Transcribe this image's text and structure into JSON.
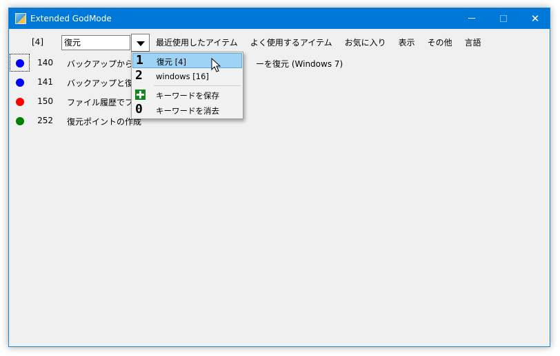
{
  "window": {
    "title": "Extended GodMode",
    "close_glyph": "✕"
  },
  "toolbar": {
    "count": "[4]",
    "search_value": "復元"
  },
  "menubar": {
    "items": [
      "最近使用したアイテム",
      "よく使用するアイテム",
      "お気に入り",
      "表示",
      "その他",
      "言語"
    ]
  },
  "rows": [
    {
      "color": "#0000ff",
      "number": "140",
      "label_left": "バックアップからデー",
      "label_right": "ーを復元 (Windows 7)"
    },
    {
      "color": "#0000ff",
      "number": "141",
      "label": "バックアップと復元"
    },
    {
      "color": "#ff0000",
      "number": "150",
      "label": "ファイル履歴でファ"
    },
    {
      "color": "#008000",
      "number": "252",
      "label": "復元ポイントの作成"
    }
  ],
  "popup": {
    "items": [
      {
        "icon": "1",
        "text": "復元 [4]"
      },
      {
        "icon": "2",
        "text": "windows [16]"
      },
      {
        "icon": "plus-icon",
        "text": "キーワードを保存"
      },
      {
        "icon": "0",
        "text": "キーワードを消去"
      }
    ]
  },
  "colors": {
    "titlebar": "#0078d7",
    "highlight": "#9fd3f5",
    "window_bg": "#f0f0f0"
  }
}
